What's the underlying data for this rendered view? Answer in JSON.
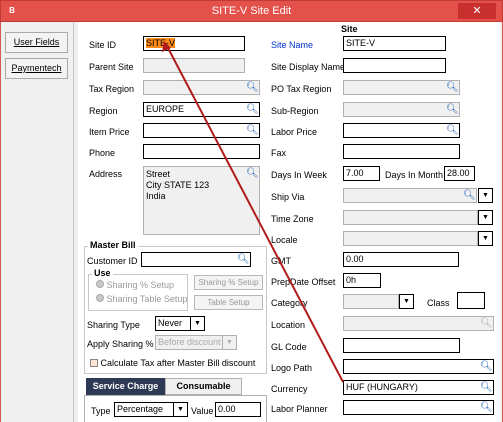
{
  "window": {
    "title": "SITE-V Site Edit",
    "app_icon": "B",
    "close": "✕"
  },
  "sidebar": {
    "items": [
      {
        "label": "User Fields"
      },
      {
        "label": "Paymentech"
      }
    ]
  },
  "left": {
    "site_id": {
      "label": "Site ID",
      "value": "SITE-V"
    },
    "parent_site": {
      "label": "Parent Site",
      "value": ""
    },
    "tax_region": {
      "label": "Tax Region",
      "value": ""
    },
    "region": {
      "label": "Region",
      "value": "EUROPE"
    },
    "item_price": {
      "label": "Item Price",
      "value": ""
    },
    "phone": {
      "label": "Phone",
      "value": ""
    },
    "address": {
      "label": "Address",
      "lines": [
        "Street",
        "City STATE 123",
        "India"
      ]
    }
  },
  "master_bill": {
    "title": "Master Bill",
    "customer_id": {
      "label": "Customer ID",
      "value": ""
    },
    "use_title": "Use",
    "sharing_pct_setup": "Sharing % Setup",
    "sharing_table_setup": "Sharing Table Setup",
    "sharing_pct_btn": "Sharing % Setup",
    "table_setup_btn": "Table Setup",
    "sharing_type": {
      "label": "Sharing Type",
      "value": "Never"
    },
    "apply_sharing": {
      "label": "Apply Sharing %",
      "value": "Before discount"
    },
    "calc_tax": "Calculate Tax after Master Bill discount"
  },
  "tabs": [
    {
      "label": "Service Charge",
      "selected": true
    },
    {
      "label": "Consumable",
      "selected": false
    }
  ],
  "service": {
    "type_label": "Type",
    "type_value": "Percentage",
    "value_label": "Value",
    "value": "0.00"
  },
  "right": {
    "section_title": "Site",
    "site_name": {
      "label": "Site Name",
      "value": "SITE-V"
    },
    "display_name": {
      "label": "Site Display Name",
      "value": ""
    },
    "po_tax_region": {
      "label": "PO Tax Region",
      "value": ""
    },
    "sub_region": {
      "label": "Sub-Region",
      "value": ""
    },
    "labor_price": {
      "label": "Labor Price",
      "value": ""
    },
    "fax": {
      "label": "Fax",
      "value": ""
    },
    "days_in_week": {
      "label": "Days In Week",
      "value": "7.00"
    },
    "days_in_month": {
      "label": "Days In Month",
      "value": "28.00"
    },
    "ship_via": {
      "label": "Ship Via",
      "value": ""
    },
    "time_zone": {
      "label": "Time Zone",
      "value": ""
    },
    "locale": {
      "label": "Locale",
      "value": ""
    },
    "gmt": {
      "label": "GMT",
      "value": "0.00"
    },
    "prepdate_offset": {
      "label": "PrepDate Offset",
      "value": "0h"
    },
    "category": {
      "label": "Category",
      "value": ""
    },
    "class": {
      "label": "Class",
      "value": ""
    },
    "location": {
      "label": "Location",
      "value": ""
    },
    "gl_code": {
      "label": "GL Code",
      "value": ""
    },
    "logo_path": {
      "label": "Logo Path",
      "value": ""
    },
    "currency": {
      "label": "Currency",
      "value": "HUF (HUNGARY)"
    },
    "labor_planner": {
      "label": "Labor Planner",
      "value": ""
    }
  },
  "colors": {
    "title_bar": "#e4514b",
    "highlight": "#ff8c1a",
    "annotation_line": "#b01c1c",
    "link_label": "#0033cc"
  },
  "icons": {
    "search": "search-icon",
    "dropdown": "chevron-down-icon"
  }
}
